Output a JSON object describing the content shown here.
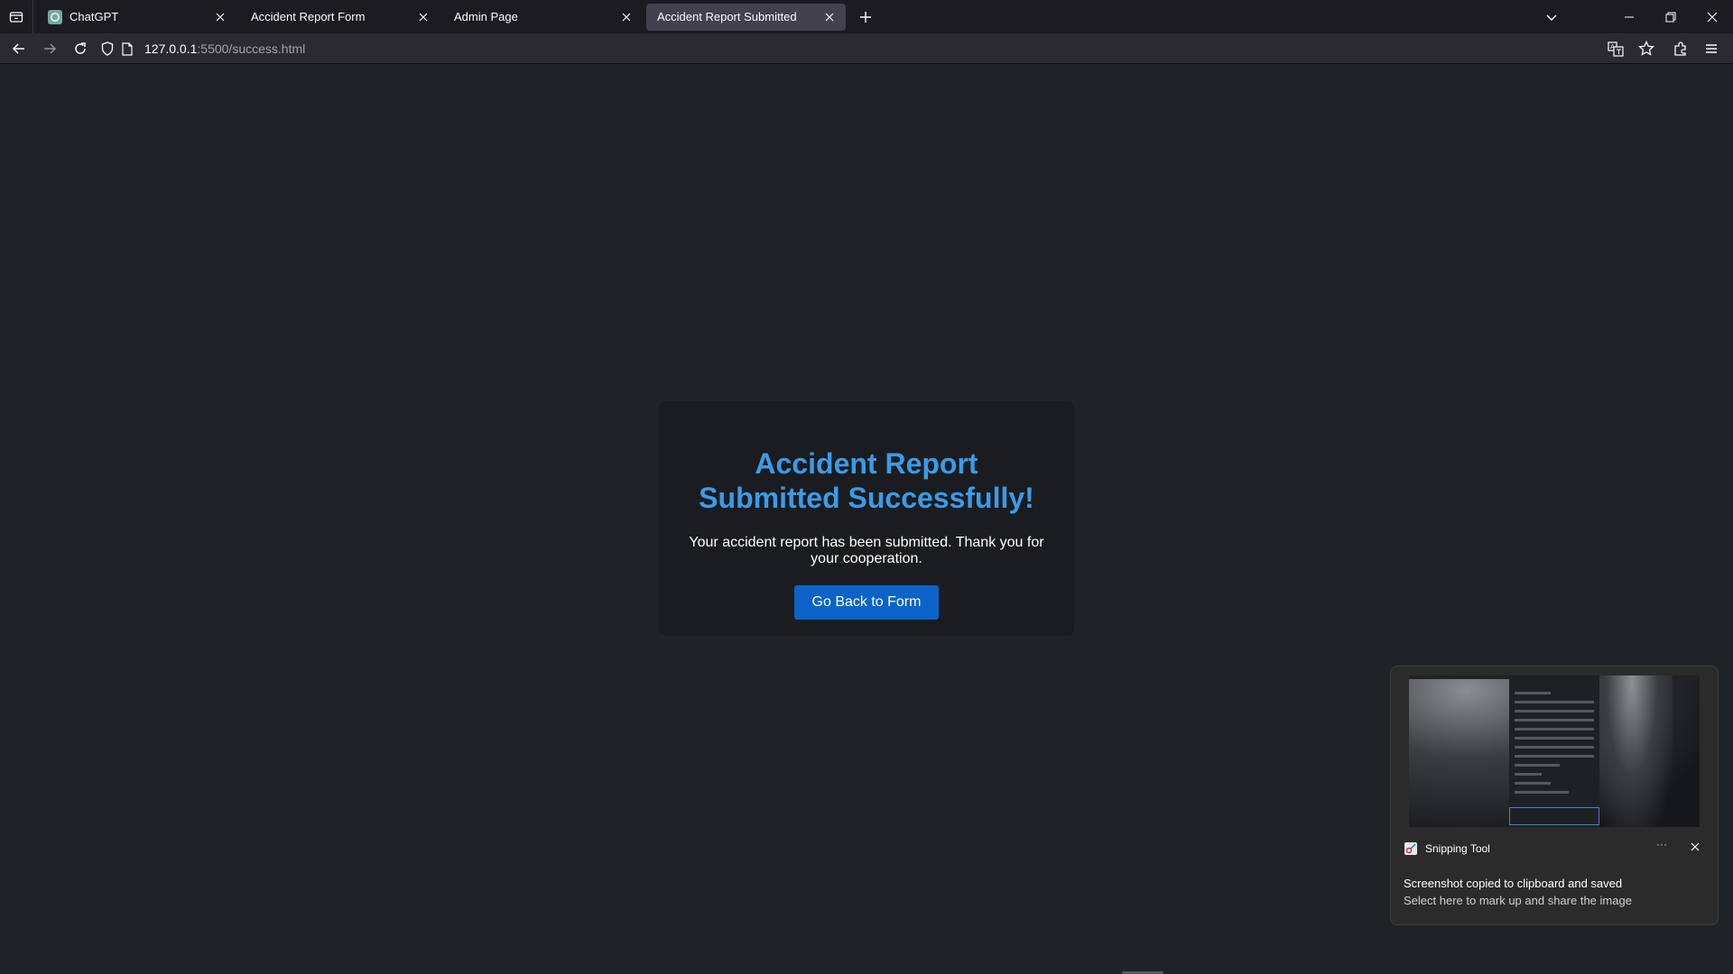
{
  "tabs": [
    {
      "label": "ChatGPT",
      "active": false,
      "favicon": "chatgpt-icon"
    },
    {
      "label": "Accident Report Form",
      "active": false
    },
    {
      "label": "Admin Page",
      "active": false
    },
    {
      "label": "Accident Report Submitted",
      "active": true
    }
  ],
  "navbar": {
    "url_host": "127.0.0.1",
    "url_rest": ":5500/success.html"
  },
  "page": {
    "heading": "Accident Report Submitted Successfully!",
    "message": "Your accident report has been submitted. Thank you for your cooperation.",
    "button_label": "Go Back to Form"
  },
  "toast": {
    "app_name": "Snipping Tool",
    "more_label": "···",
    "title": "Screenshot copied to clipboard and saved",
    "subtitle": "Select here to mark up and share the image"
  },
  "colors": {
    "page_bg": "#1f2326",
    "card_bg": "#1a1c1f",
    "heading": "#3a9be8",
    "button_bg": "#0b63c9"
  }
}
